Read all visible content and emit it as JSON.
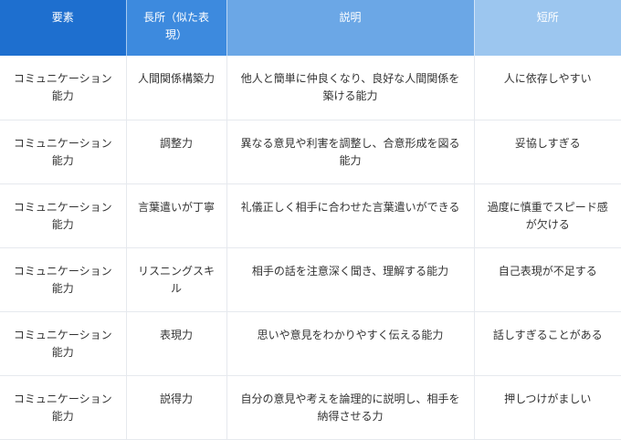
{
  "table": {
    "headers": [
      "要素",
      "長所（似た表現）",
      "説明",
      "短所"
    ],
    "rows": [
      [
        "コミュニケーション能力",
        "人間関係構築力",
        "他人と簡単に仲良くなり、良好な人間関係を築ける能力",
        "人に依存しやすい"
      ],
      [
        "コミュニケーション能力",
        "調整力",
        "異なる意見や利害を調整し、合意形成を図る能力",
        "妥協しすぎる"
      ],
      [
        "コミュニケーション能力",
        "言葉遣いが丁寧",
        "礼儀正しく相手に合わせた言葉遣いができる",
        "過度に慎重でスピード感が欠ける"
      ],
      [
        "コミュニケーション能力",
        "リスニングスキル",
        "相手の話を注意深く聞き、理解する能力",
        "自己表現が不足する"
      ],
      [
        "コミュニケーション能力",
        "表現力",
        "思いや意見をわかりやすく伝える能力",
        "話しすぎることがある"
      ],
      [
        "コミュニケーション能力",
        "説得力",
        "自分の意見や考えを論理的に説明し、相手を納得させる力",
        "押しつけがましい"
      ]
    ]
  }
}
